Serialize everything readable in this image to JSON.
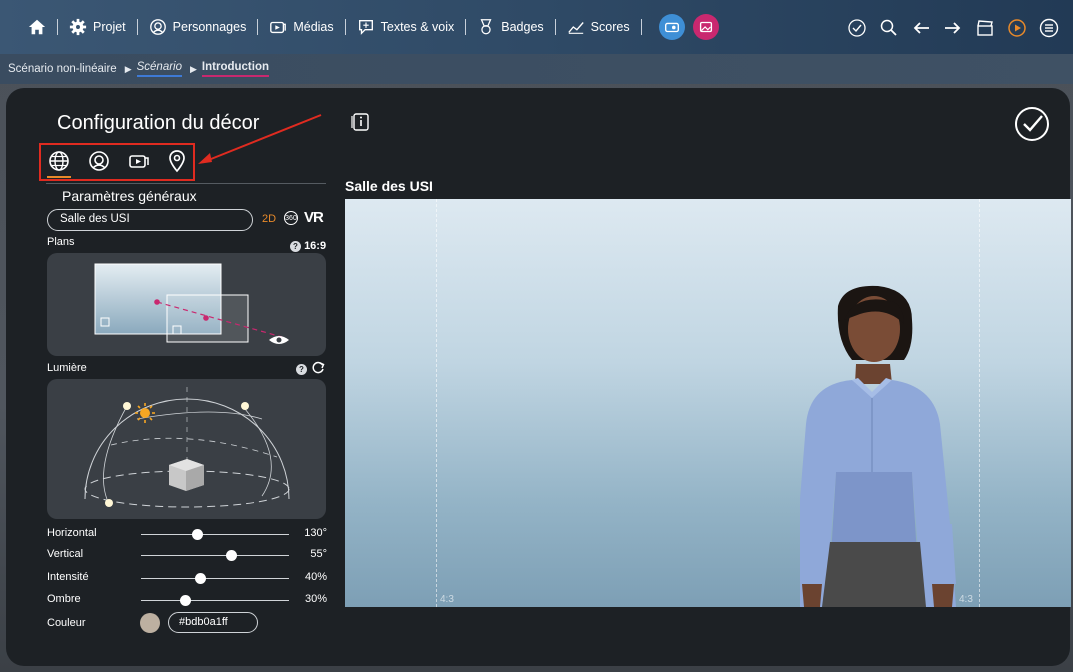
{
  "nav": {
    "items": [
      {
        "label": "Projet",
        "icon": "gear-icon"
      },
      {
        "label": "Personnages",
        "icon": "character-icon"
      },
      {
        "label": "Médias",
        "icon": "media-icon"
      },
      {
        "label": "Textes & voix",
        "icon": "speech-icon"
      },
      {
        "label": "Badges",
        "icon": "badge-icon"
      },
      {
        "label": "Scores",
        "icon": "scores-icon"
      }
    ],
    "accent_blue": "#3e8fd6",
    "accent_pink": "#c9286f"
  },
  "breadcrumb": {
    "root": "Scénario non-linéaire",
    "middle": "Scénario",
    "current": "Introduction"
  },
  "panel": {
    "title": "Configuration du décor",
    "section_title": "Paramètres généraux",
    "scene_name": "Salle des USI",
    "mode_2d": "2D",
    "mode_360": "360",
    "mode_vr": "VR",
    "plans_label": "Plans",
    "ratio": "16:9",
    "light_label": "Lumière",
    "help_glyph": "?",
    "sliders": [
      {
        "label": "Horizontal",
        "value": "130°",
        "level": 0.38
      },
      {
        "label": "Vertical",
        "value": "55°",
        "level": 0.61
      },
      {
        "label": "Intensité",
        "value": "40%",
        "level": 0.4
      },
      {
        "label": "Ombre",
        "value": "30%",
        "level": 0.3
      }
    ],
    "color_label": "Couleur",
    "color_value": "#bdb0a1ff",
    "color_hex": "#bdb0a1"
  },
  "preview": {
    "title": "Salle des USI",
    "guide_left": "4:3",
    "guide_right": "4:3"
  }
}
